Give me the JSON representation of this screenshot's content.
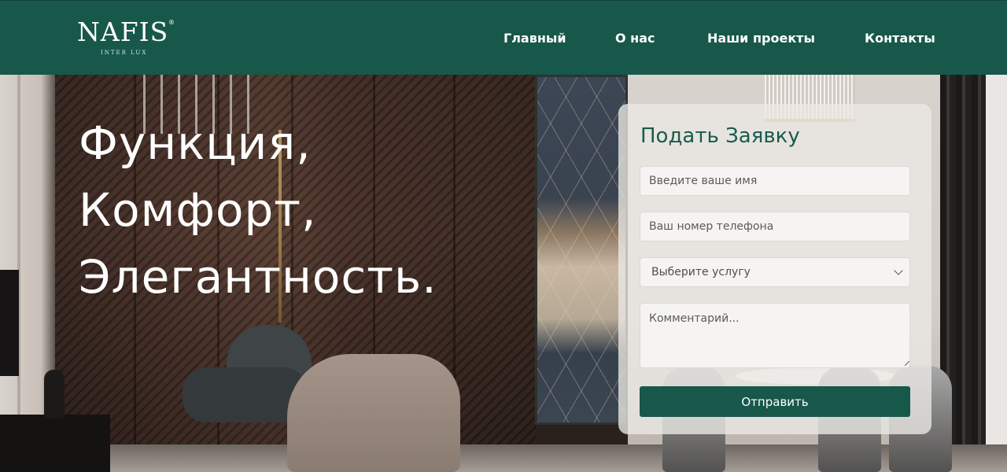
{
  "header": {
    "logo": {
      "name": "NAFIS",
      "registered": "®",
      "tagline": "INTER LUX"
    },
    "nav": [
      {
        "label": "Главный"
      },
      {
        "label": "О нас"
      },
      {
        "label": "Наши проекты"
      },
      {
        "label": "Контакты"
      }
    ]
  },
  "hero": {
    "title_lines": [
      "Функция,",
      "Комфорт,",
      "Элегантность."
    ]
  },
  "form": {
    "title": "Подать Заявку",
    "name_placeholder": "Введите ваше имя",
    "phone_placeholder": "Ваш номер телефона",
    "service_selected": "Выберите услугу",
    "comment_placeholder": "Комментарий...",
    "submit_label": "Отправить"
  },
  "colors": {
    "brand_green": "#17584b",
    "text_white": "#ffffff"
  }
}
